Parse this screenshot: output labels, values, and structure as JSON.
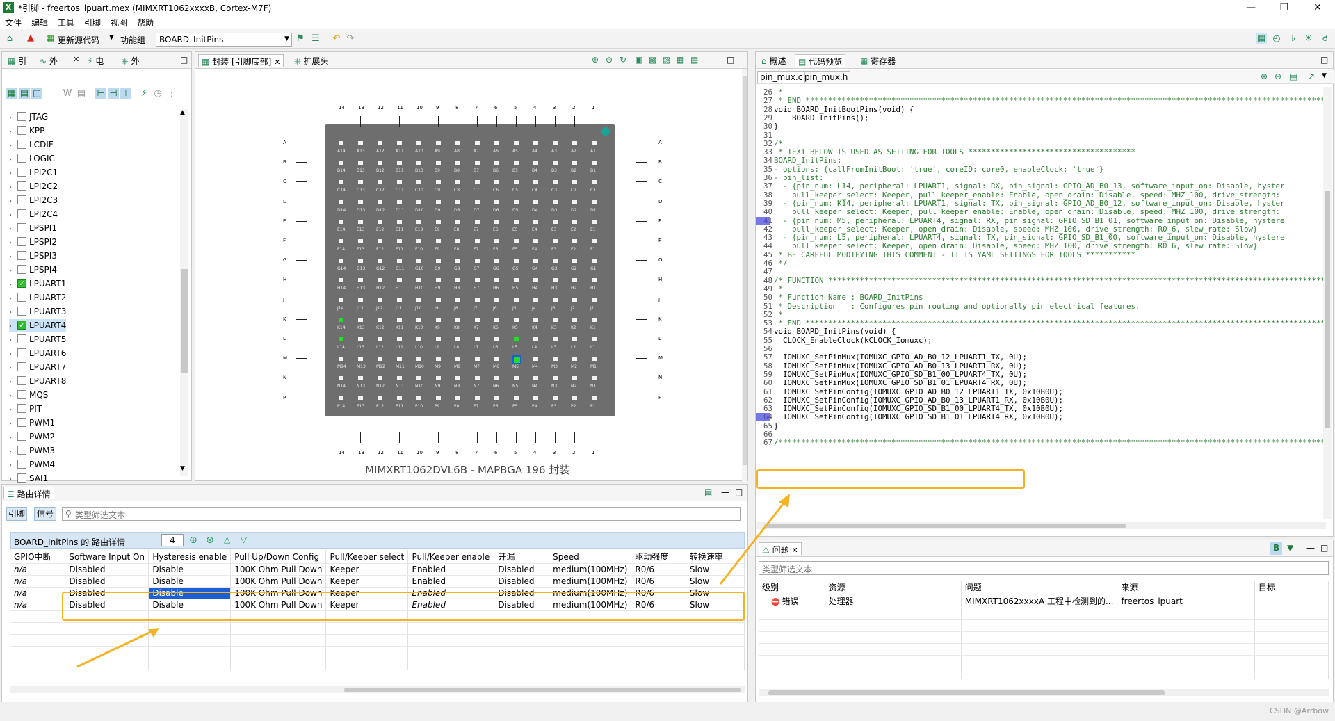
{
  "window": {
    "title": "*引脚 - freertos_lpuart.mex (MIMXRT1062xxxxB, Cortex-M7F)"
  },
  "menu": [
    "文件",
    "编辑",
    "工具",
    "引脚",
    "视图",
    "帮助"
  ],
  "toolbar": {
    "update_code": "更新源代码",
    "function_group_label": "功能组",
    "function_group_value": "BOARD_InitPins"
  },
  "left_panel": {
    "tabs": [
      "引",
      "外",
      "电",
      "外"
    ],
    "peripherals": [
      {
        "name": "JTAG",
        "checked": false
      },
      {
        "name": "KPP",
        "checked": false
      },
      {
        "name": "LCDIF",
        "checked": false
      },
      {
        "name": "LOGIC",
        "checked": false
      },
      {
        "name": "LPI2C1",
        "checked": false
      },
      {
        "name": "LPI2C2",
        "checked": false
      },
      {
        "name": "LPI2C3",
        "checked": false
      },
      {
        "name": "LPI2C4",
        "checked": false
      },
      {
        "name": "LPSPI1",
        "checked": false
      },
      {
        "name": "LPSPI2",
        "checked": false
      },
      {
        "name": "LPSPI3",
        "checked": false
      },
      {
        "name": "LPSPI4",
        "checked": false
      },
      {
        "name": "LPUART1",
        "checked": true
      },
      {
        "name": "LPUART2",
        "checked": false
      },
      {
        "name": "LPUART3",
        "checked": false
      },
      {
        "name": "LPUART4",
        "checked": true
      },
      {
        "name": "LPUART5",
        "checked": false
      },
      {
        "name": "LPUART6",
        "checked": false
      },
      {
        "name": "LPUART7",
        "checked": false
      },
      {
        "name": "LPUART8",
        "checked": false
      },
      {
        "name": "MQS",
        "checked": false
      },
      {
        "name": "PIT",
        "checked": false
      },
      {
        "name": "PWM1",
        "checked": false
      },
      {
        "name": "PWM2",
        "checked": false
      },
      {
        "name": "PWM3",
        "checked": false
      },
      {
        "name": "PWM4",
        "checked": false
      },
      {
        "name": "SAI1",
        "checked": false
      }
    ]
  },
  "package_panel": {
    "tabs": [
      "封装 [引脚底部]",
      "扩展头"
    ],
    "caption": "MIMXRT1062DVL6B - MAPBGA 196 封装",
    "columns": [
      "14",
      "13",
      "12",
      "11",
      "10",
      "9",
      "8",
      "7",
      "6",
      "5",
      "4",
      "3",
      "2",
      "1"
    ],
    "rows": [
      "A",
      "B",
      "C",
      "D",
      "E",
      "F",
      "G",
      "H",
      "J",
      "K",
      "L",
      "M",
      "N",
      "P"
    ]
  },
  "routing": {
    "tab": "路由详情",
    "filter_tabs": [
      "引脚",
      "信号"
    ],
    "filter_placeholder": "类型筛选文本",
    "header_title": "BOARD_InitPins 的 路由详情",
    "count": "4",
    "columns": [
      "GPIO中断",
      "Software Input On",
      "Hysteresis enable",
      "Pull Up/Down Config",
      "Pull/Keeper select",
      "Pull/Keeper enable",
      "开漏",
      "Speed",
      "驱动强度",
      "转换速率"
    ],
    "rows": [
      [
        "n/a",
        "Disabled",
        "Disable",
        "100K Ohm Pull Down",
        "Keeper",
        "Enabled",
        "Disabled",
        "medium(100MHz)",
        "R0/6",
        "Slow"
      ],
      [
        "n/a",
        "Disabled",
        "Disable",
        "100K Ohm Pull Down",
        "Keeper",
        "Enabled",
        "Disabled",
        "medium(100MHz)",
        "R0/6",
        "Slow"
      ],
      [
        "n/a",
        "Disabled",
        "Disable",
        "100K Ohm Pull Down",
        "Keeper",
        "Enabled",
        "Disabled",
        "medium(100MHz)",
        "R0/6",
        "Slow"
      ],
      [
        "n/a",
        "Disabled",
        "Disable",
        "100K Ohm Pull Down",
        "Keeper",
        "Enabled",
        "Disabled",
        "medium(100MHz)",
        "R0/6",
        "Slow"
      ]
    ]
  },
  "code_panel": {
    "tabs": [
      "概述",
      "代码预览",
      "寄存器"
    ],
    "file_tabs": [
      "pin_mux.c",
      "pin_mux.h"
    ],
    "lines": [
      {
        "n": "26",
        "t": " *"
      },
      {
        "n": "27",
        "t": " * END ****************************************************************************************************************************"
      },
      {
        "n": "28",
        "t": "void BOARD_InitBootPins(void) {"
      },
      {
        "n": "29",
        "t": "    BOARD_InitPins();"
      },
      {
        "n": "30",
        "t": "}"
      },
      {
        "n": "31",
        "t": ""
      },
      {
        "n": "32",
        "t": "/*"
      },
      {
        "n": "33",
        "t": " * TEXT BELOW IS USED AS SETTING FOR TOOLS *************************************"
      },
      {
        "n": "34",
        "t": "BOARD_InitPins:"
      },
      {
        "n": "35",
        "t": "- options: {callFromInitBoot: 'true', coreID: core0, enableClock: 'true'}"
      },
      {
        "n": "36",
        "t": "- pin_list:"
      },
      {
        "n": "37",
        "t": "  - {pin_num: L14, peripheral: LPUART1, signal: RX, pin_signal: GPIO_AD_B0_13, software_input_on: Disable, hyster"
      },
      {
        "n": "38",
        "t": "    pull_keeper_select: Keeper, pull_keeper_enable: Enable, open_drain: Disable, speed: MHZ_100, drive_strength:"
      },
      {
        "n": "39",
        "t": "  - {pin_num: K14, peripheral: LPUART1, signal: TX, pin_signal: GPIO_AD_B0_12, software_input_on: Disable, hyster"
      },
      {
        "n": "40",
        "t": "    pull_keeper_select: Keeper, pull_keeper_enable: Enable, open_drain: Disable, speed: MHZ_100, drive_strength:"
      },
      {
        "n": "41",
        "t": "  - {pin_num: M5, peripheral: LPUART4, signal: RX, pin_signal: GPIO_SD_B1_01, software_input_on: Disable, hystere"
      },
      {
        "n": "42",
        "t": "    pull_keeper_select: Keeper, open_drain: Disable, speed: MHZ_100, drive_strength: R0_6, slew_rate: Slow}"
      },
      {
        "n": "43",
        "t": "  - {pin_num: L5, peripheral: LPUART4, signal: TX, pin_signal: GPIO_SD_B1_00, software_input_on: Disable, hystere"
      },
      {
        "n": "44",
        "t": "    pull_keeper_select: Keeper, open_drain: Disable, speed: MHZ_100, drive_strength: R0_6, slew_rate: Slow}"
      },
      {
        "n": "45",
        "t": " * BE CAREFUL MODIFYING THIS COMMENT - IT IS YAML SETTINGS FOR TOOLS ***********"
      },
      {
        "n": "46",
        "t": " */"
      },
      {
        "n": "47",
        "t": ""
      },
      {
        "n": "48",
        "t": "/* FUNCTION ************************************************************************************************************************"
      },
      {
        "n": "49",
        "t": " *"
      },
      {
        "n": "50",
        "t": " * Function Name : BOARD_InitPins"
      },
      {
        "n": "51",
        "t": " * Description   : Configures pin routing and optionally pin electrical features."
      },
      {
        "n": "52",
        "t": " *"
      },
      {
        "n": "53",
        "t": " * END ****************************************************************************************************************************"
      },
      {
        "n": "54",
        "t": "void BOARD_InitPins(void) {"
      },
      {
        "n": "55",
        "t": "  CLOCK_EnableClock(kCLOCK_Iomuxc);"
      },
      {
        "n": "56",
        "t": ""
      },
      {
        "n": "57",
        "t": "  IOMUXC_SetPinMux(IOMUXC_GPIO_AD_B0_12_LPUART1_TX, 0U);"
      },
      {
        "n": "58",
        "t": "  IOMUXC_SetPinMux(IOMUXC_GPIO_AD_B0_13_LPUART1_RX, 0U);"
      },
      {
        "n": "59",
        "t": "  IOMUXC_SetPinMux(IOMUXC_GPIO_SD_B1_00_LPUART4_TX, 0U);"
      },
      {
        "n": "60",
        "t": "  IOMUXC_SetPinMux(IOMUXC_GPIO_SD_B1_01_LPUART4_RX, 0U);"
      },
      {
        "n": "61",
        "t": "  IOMUXC_SetPinConfig(IOMUXC_GPIO_AD_B0_12_LPUART1_TX, 0x10B0U);"
      },
      {
        "n": "62",
        "t": "  IOMUXC_SetPinConfig(IOMUXC_GPIO_AD_B0_13_LPUART1_RX, 0x10B0U);"
      },
      {
        "n": "63",
        "t": "  IOMUXC_SetPinConfig(IOMUXC_GPIO_SD_B1_00_LPUART4_TX, 0x10B0U);"
      },
      {
        "n": "64",
        "t": "  IOMUXC_SetPinConfig(IOMUXC_GPIO_SD_B1_01_LPUART4_RX, 0x10B0U);"
      },
      {
        "n": "65",
        "t": "}"
      },
      {
        "n": "66",
        "t": ""
      },
      {
        "n": "67",
        "t": "/***************************************************************************************************************************"
      }
    ]
  },
  "problems": {
    "tab": "问题",
    "filter_placeholder": "类型筛选文本",
    "columns": [
      "级别",
      "资源",
      "问题",
      "来源",
      "目标"
    ],
    "rows": [
      [
        "错误",
        "处理器",
        "MIMXRT1062xxxxA 工程中检测到的...",
        "freertos_lpuart",
        ""
      ]
    ]
  },
  "watermark": "CSDN @Arrbow",
  "colors": {
    "accent_orange": "#f5b324",
    "pin_green": "#22dd22",
    "selected_blue": "#1f5fd6"
  }
}
